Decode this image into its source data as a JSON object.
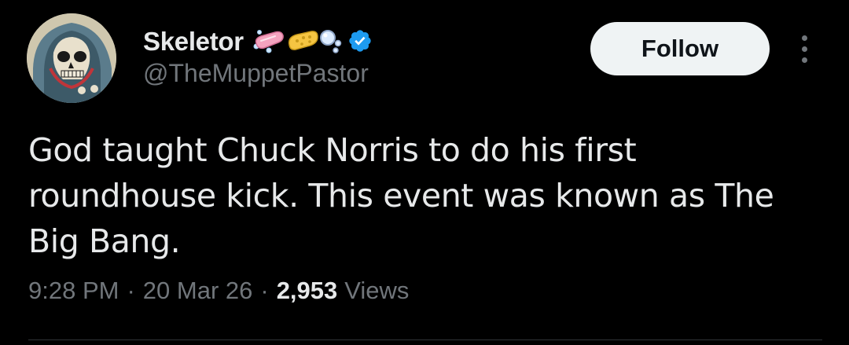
{
  "author": {
    "display_name": "Skeletor",
    "handle": "@TheMuppetPastor",
    "verified": true,
    "badge_emojis": [
      "soap-icon",
      "sponge-icon",
      "bubbles-icon"
    ],
    "verified_color": "#1d9bf0"
  },
  "actions": {
    "follow_label": "Follow",
    "more_icon": "more-options-icon"
  },
  "tweet": {
    "lines": [
      "God taught Chuck Norris to do his first",
      "roundhouse kick. This event was known as The",
      "Big Bang."
    ]
  },
  "meta": {
    "time": "9:28 PM",
    "separator": "·",
    "date": "20 Mar 26",
    "views_count": "2,953",
    "views_label": "Views"
  },
  "colors": {
    "background": "#000000",
    "primary_text": "#e7e9ea",
    "secondary_text": "#71767b",
    "follow_button_bg": "#eff3f4"
  }
}
